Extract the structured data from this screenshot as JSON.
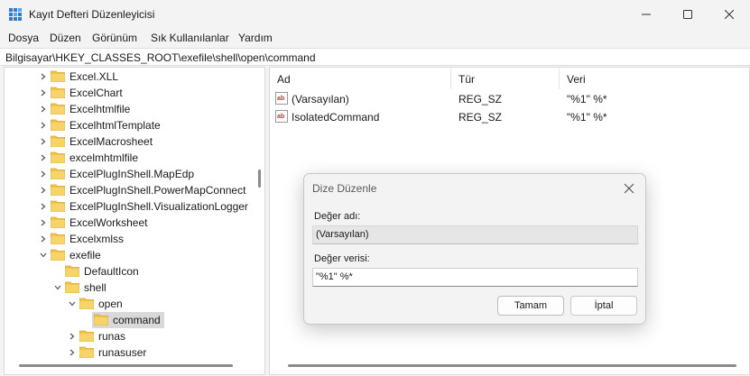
{
  "window": {
    "title": "Kayıt Defteri Düzenleyicisi",
    "icon": "registry-editor-icon"
  },
  "menu": [
    "Dosya",
    "Düzen",
    "Görünüm",
    "Sık Kullanılanlar",
    "Yardım"
  ],
  "address": "Bilgisayar\\HKEY_CLASSES_ROOT\\exefile\\shell\\open\\command",
  "tree": [
    {
      "label": "Excel.XLL",
      "expander": "collapsed"
    },
    {
      "label": "ExcelChart",
      "expander": "collapsed"
    },
    {
      "label": "Excelhtmlfile",
      "expander": "collapsed"
    },
    {
      "label": "ExcelhtmlTemplate",
      "expander": "collapsed"
    },
    {
      "label": "ExcelMacrosheet",
      "expander": "collapsed"
    },
    {
      "label": "excelmhtmlfile",
      "expander": "collapsed"
    },
    {
      "label": "ExcelPlugInShell.MapEdp",
      "expander": "collapsed"
    },
    {
      "label": "ExcelPlugInShell.PowerMapConnect",
      "expander": "collapsed"
    },
    {
      "label": "ExcelPlugInShell.VisualizationLogger",
      "expander": "collapsed"
    },
    {
      "label": "ExcelWorksheet",
      "expander": "collapsed"
    },
    {
      "label": "Excelxmlss",
      "expander": "collapsed"
    },
    {
      "label": "exefile",
      "expander": "expanded"
    },
    {
      "label": "DefaultIcon",
      "expander": "none"
    },
    {
      "label": "shell",
      "expander": "expanded"
    },
    {
      "label": "open",
      "expander": "expanded"
    },
    {
      "label": "command",
      "expander": "none",
      "selected": true
    },
    {
      "label": "runas",
      "expander": "collapsed"
    },
    {
      "label": "runasuser",
      "expander": "collapsed"
    }
  ],
  "columns": {
    "name": "Ad",
    "type": "Tür",
    "data": "Veri"
  },
  "values": [
    {
      "name": "(Varsayılan)",
      "type": "REG_SZ",
      "data": "\"%1\" %*"
    },
    {
      "name": "IsolatedCommand",
      "type": "REG_SZ",
      "data": "\"%1\" %*"
    }
  ],
  "dialog": {
    "title": "Dize Düzenle",
    "name_label": "Değer adı:",
    "name_value": "(Varsayılan)",
    "data_label": "Değer verisi:",
    "data_value": "\"%1\" %*",
    "ok_label": "Tamam",
    "cancel_label": "İptal"
  },
  "colors": {
    "folder": "#f0c44b",
    "selection": "#d9d9d9",
    "ab_icon": "#c0392b"
  }
}
